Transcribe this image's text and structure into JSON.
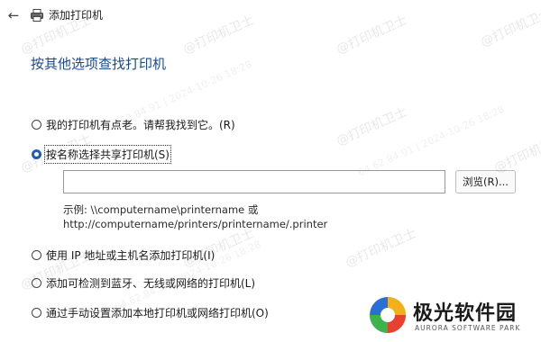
{
  "window": {
    "title": "添加打印机",
    "back_icon": "back-arrow-icon",
    "printer_icon": "printer-icon"
  },
  "heading": "按其他选项查找打印机",
  "options": [
    {
      "label": "我的打印机有点老。请帮我找到它。(R)",
      "checked": false
    },
    {
      "label": "按名称选择共享打印机(S)",
      "checked": true
    },
    {
      "label": "使用 IP 地址或主机名添加打印机(I)",
      "checked": false
    },
    {
      "label": "添加可检测到蓝牙、无线或网络的打印机(L)",
      "checked": false
    },
    {
      "label": "通过手动设置添加本地打印机或网络打印机(O)",
      "checked": false
    }
  ],
  "share_input": {
    "value": "",
    "placeholder": ""
  },
  "browse_label": "浏览(R)...",
  "example": {
    "line1": "示例: \\\\computername\\printername 或",
    "line2": "http://computername/printers/printername/.printer"
  },
  "watermark": {
    "text": "@打印机卫士",
    "sub": "64.62.84.91 | 2024-10-26 18:28"
  },
  "brand": {
    "name": "极光软件园",
    "sub": "AURORA SOFTWARE PARK"
  },
  "colors": {
    "accent": "#1f5fb8",
    "heading": "#1a4a8c"
  }
}
